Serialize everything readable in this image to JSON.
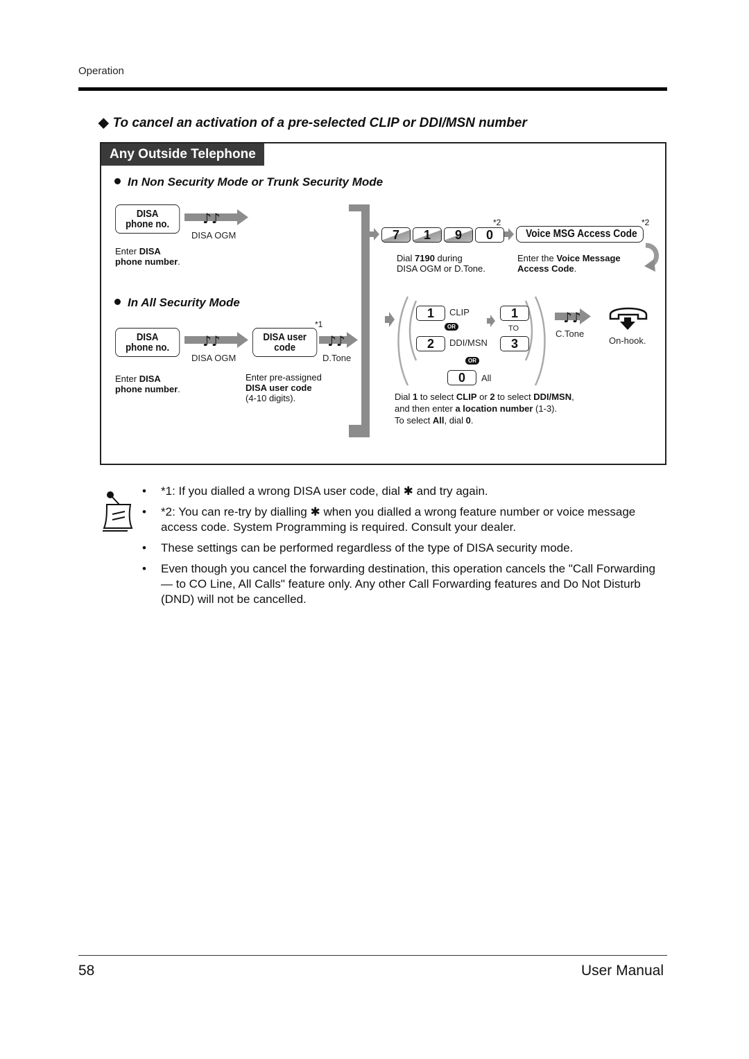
{
  "header": {
    "section_label": "Operation"
  },
  "section": {
    "icon": "diamond-bullet",
    "title": "To cancel an activation of a pre-selected CLIP or DDI/MSN number"
  },
  "panel": {
    "tab_label": "Any Outside Telephone",
    "mode_non_security": {
      "title": "In Non Security Mode or Trunk Security Mode",
      "key_line1": "DISA",
      "key_line2": "phone no.",
      "tone_label": "DISA OGM",
      "desc_prefix": "Enter ",
      "desc_bold1": "DISA",
      "desc_bold2": "phone number",
      "desc_suffix": "."
    },
    "mode_all_security": {
      "title": "In All Security Mode",
      "key_line1": "DISA",
      "key_line2": "phone no.",
      "tone1_label": "DISA OGM",
      "user_code_line1": "DISA user",
      "user_code_line2": "code",
      "user_code_footnote": "*1",
      "tone2_label": "D.Tone",
      "desc1_prefix": "Enter ",
      "desc1_bold1": "DISA",
      "desc1_bold2": "phone number",
      "desc1_suffix": ".",
      "desc2_line1": "Enter pre-assigned",
      "desc2_bold": "DISA user code",
      "desc2_line3": "(4-10 digits)."
    },
    "common_steps": {
      "dial_keys": [
        "7",
        "1",
        "9",
        "0"
      ],
      "dial_footnote": "*2",
      "dial_desc_prefix": "Dial ",
      "dial_desc_bold": "7190",
      "dial_desc_suffix": " during",
      "dial_desc_line2": "DISA OGM or D.Tone.",
      "vmsg_key": "Voice MSG Access Code",
      "vmsg_footnote": "*2",
      "vmsg_desc_prefix": "Enter the ",
      "vmsg_desc_bold1": "Voice Message",
      "vmsg_desc_bold2": "Access Code",
      "vmsg_desc_suffix": ".",
      "retry_icon": "curved-return-arrow",
      "select_options": [
        {
          "key": "1",
          "label": "CLIP"
        },
        {
          "key": "2",
          "label": "DDI/MSN"
        },
        {
          "key": "0",
          "label": "All"
        }
      ],
      "or_label": "OR",
      "location_from": "1",
      "location_to": "3",
      "to_label": "TO",
      "confirm_tone": "C.Tone",
      "hangup_label": "On-hook.",
      "select_desc_line1": {
        "a": "Dial ",
        "b": "1",
        "c": " to select ",
        "d": "CLIP",
        "e": " or ",
        "f": "2",
        "g": " to select ",
        "h": "DDI/MSN",
        "i": ","
      },
      "select_desc_line2": {
        "a": "and then enter ",
        "b": "a location number",
        "c": " (1-3)."
      },
      "select_desc_line3": {
        "a": "To select ",
        "b": "All",
        "c": ", dial ",
        "d": "0",
        "e": "."
      }
    }
  },
  "notes": {
    "icon": "memo-note-icon",
    "bullet": "•",
    "items": [
      {
        "text_a": "*1: If you dialled a wrong DISA user code, dial ",
        "star": "✱",
        "text_b": " and try again."
      },
      {
        "text_a": "*2: You can re-try by dialling ",
        "star": "✱",
        "text_b": " when you dialled a wrong feature number or voice message access code. System Programming is required. Consult your dealer."
      },
      {
        "text_a": "These settings can be performed regardless of the type of DISA security mode.",
        "star": "",
        "text_b": ""
      },
      {
        "text_a": "Even though you cancel the forwarding destination, this operation cancels the \"Call Forwarding — to CO Line, All Calls\" feature only. Any other Call Forwarding features and Do Not Disturb (DND) will not be cancelled.",
        "star": "",
        "text_b": ""
      }
    ]
  },
  "footer": {
    "page_number": "58",
    "manual_name": "User Manual"
  }
}
